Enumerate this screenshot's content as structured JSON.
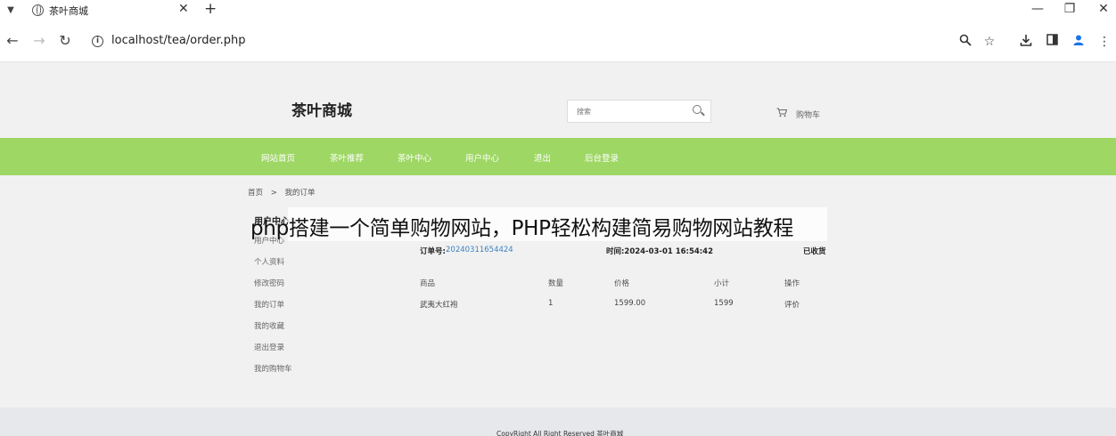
{
  "browser": {
    "tab_title": "茶叶商城",
    "tab_close": "✕",
    "new_tab": "+",
    "url": "localhost/tea/order.php",
    "controls": {
      "minimize": "—",
      "restore": "❐",
      "close": "✕"
    }
  },
  "site": {
    "logo": "茶叶商城",
    "search_placeholder": "搜索",
    "cart_label": "购物车"
  },
  "nav": {
    "items": [
      {
        "label": "网站首页"
      },
      {
        "label": "茶叶推荐"
      },
      {
        "label": "茶叶中心"
      },
      {
        "label": "用户中心"
      },
      {
        "label": "退出"
      },
      {
        "label": "后台登录"
      }
    ]
  },
  "breadcrumb": {
    "home": "首页",
    "sep": ">",
    "current": "我的订单"
  },
  "sidebar": {
    "heading": "用户中心",
    "items": [
      {
        "label": "用户中心"
      },
      {
        "label": "个人资料"
      },
      {
        "label": "修改密码"
      },
      {
        "label": "我的订单"
      },
      {
        "label": "我的收藏"
      },
      {
        "label": "退出登录"
      },
      {
        "label": "我的购物车"
      }
    ]
  },
  "order": {
    "no_label": "订单号:",
    "no_value": "20240311654424",
    "time_text": "时间:2024-03-01 16:54:42",
    "status": "已收货",
    "columns": [
      "商品",
      "数量",
      "价格",
      "小计",
      "操作"
    ],
    "rows": [
      {
        "product": "武夷大红袍",
        "qty": "1",
        "price": "1599.00",
        "subtotal": "1599",
        "action": "评价"
      }
    ]
  },
  "footer": {
    "copyright": "CopyRight All Right Reserved 茶叶商城"
  },
  "overlay": {
    "caption": "php搭建一个简单购物网站，PHP轻松构建简易购物网站教程"
  }
}
